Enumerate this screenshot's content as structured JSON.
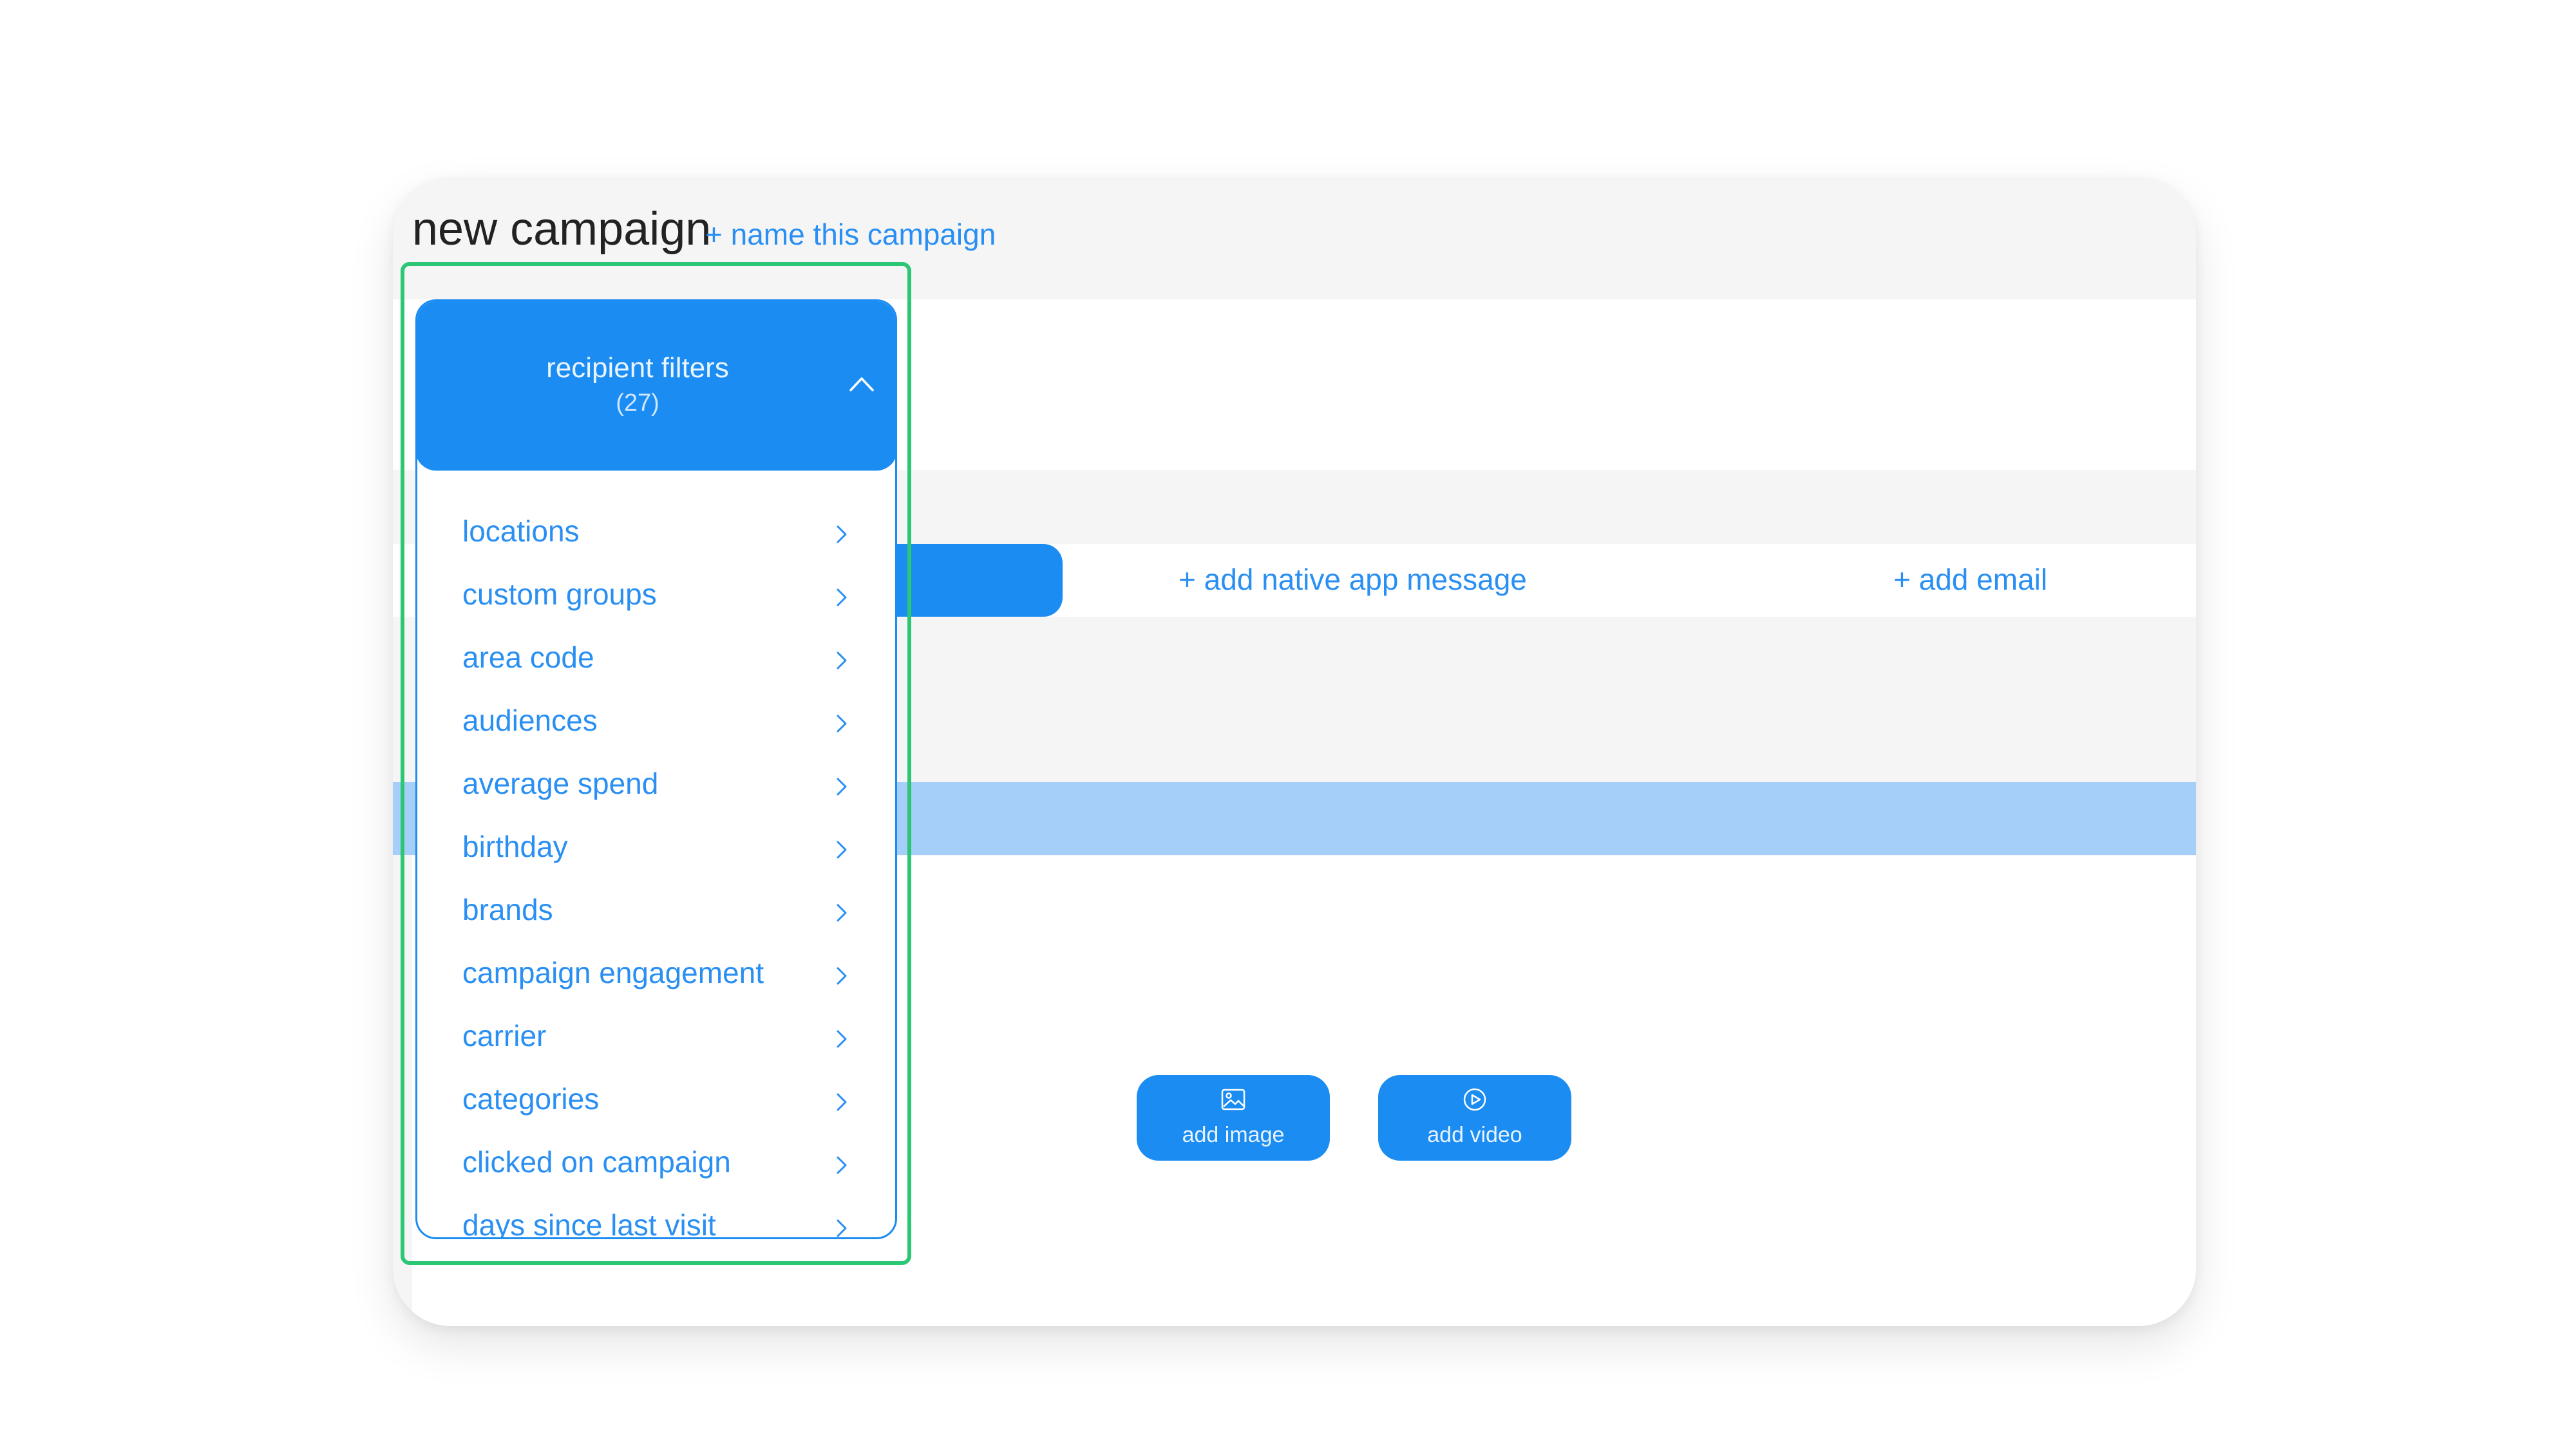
{
  "header": {
    "title": "new campaign",
    "name_link": "+ name this campaign"
  },
  "tabs": {
    "native_app": "+ add native app message",
    "email": "+ add email"
  },
  "media": {
    "add_image": "add image",
    "add_video": "add video"
  },
  "filters": {
    "title": "recipient filters",
    "count": "(27)",
    "items": [
      "locations",
      "custom groups",
      "area code",
      "audiences",
      "average spend",
      "birthday",
      "brands",
      "campaign engagement",
      "carrier",
      "categories",
      "clicked on campaign",
      "days since last visit"
    ]
  },
  "colors": {
    "accent": "#1a8cf2",
    "link": "#2a8ff2",
    "highlight": "#2bc774",
    "band_blue": "#a5cef8",
    "panel_bg": "#f5f5f5"
  },
  "icons": {
    "image": "image-icon",
    "video": "play-circle-icon",
    "collapse": "chevron-up-icon",
    "item": "chevron-right-icon"
  }
}
